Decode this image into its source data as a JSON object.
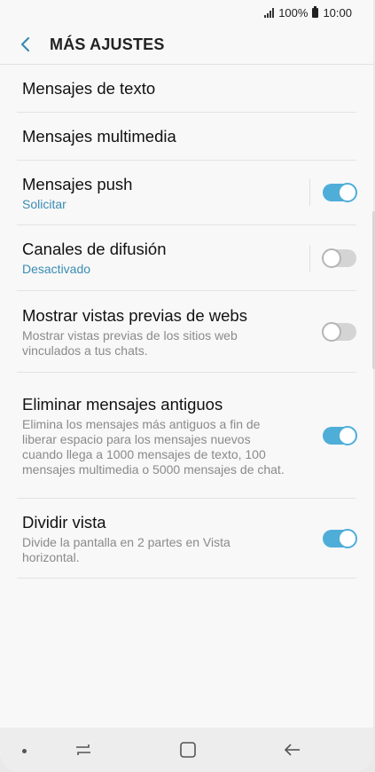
{
  "status_bar": {
    "battery_percent": "100%",
    "time": "10:00"
  },
  "header": {
    "title": "MÁS AJUSTES",
    "back_icon": "chevron-left-icon"
  },
  "colors": {
    "accent": "#3a8cb3",
    "toggle_on": "#4eaed8",
    "toggle_off": "#d4d4d4"
  },
  "settings": {
    "text_messages": {
      "label": "Mensajes de texto"
    },
    "multimedia_messages": {
      "label": "Mensajes multimedia"
    },
    "push_messages": {
      "label": "Mensajes push",
      "sub": "Solicitar",
      "enabled": true
    },
    "broadcast_channels": {
      "label": "Canales de difusión",
      "sub": "Desactivado",
      "enabled": false
    },
    "web_previews": {
      "label": "Mostrar vistas previas de webs",
      "sub": "Mostrar vistas previas de los sitios web vinculados a tus chats.",
      "enabled": false
    },
    "delete_old_messages": {
      "label": "Eliminar mensajes antiguos",
      "sub": "Elimina los mensajes más antiguos a fin de liberar espacio para los mensajes nuevos cuando llega a 1000 mensajes de texto, 100 mensajes multimedia o 5000 mensajes de chat.",
      "enabled": true
    },
    "split_view": {
      "label": "Dividir vista",
      "sub": "Divide la pantalla en 2 partes en Vista horizontal.",
      "enabled": true
    }
  },
  "nav_bar": {
    "icons": [
      "dot-icon",
      "recent-apps-icon",
      "home-icon",
      "back-icon"
    ]
  }
}
